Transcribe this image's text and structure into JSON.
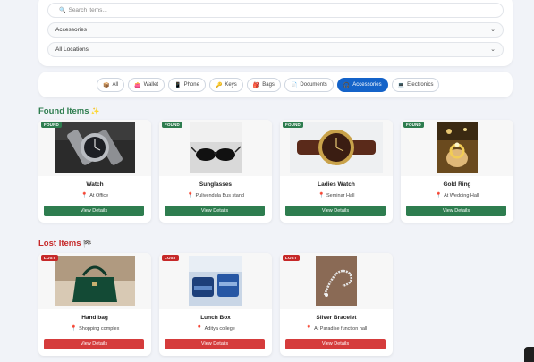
{
  "search": {
    "placeholder": "Search items..."
  },
  "filters": {
    "category": "Accessories",
    "location": "All Locations"
  },
  "chips": [
    {
      "label": "All",
      "icon": "box-icon",
      "glyph": "📦"
    },
    {
      "label": "Wallet",
      "icon": "wallet-icon",
      "glyph": "👛"
    },
    {
      "label": "Phone",
      "icon": "phone-icon",
      "glyph": "📱"
    },
    {
      "label": "Keys",
      "icon": "key-icon",
      "glyph": "🔑"
    },
    {
      "label": "Bags",
      "icon": "bag-icon",
      "glyph": "🎒"
    },
    {
      "label": "Documents",
      "icon": "document-icon",
      "glyph": "📄"
    },
    {
      "label": "Accessories",
      "icon": "headphones-icon",
      "glyph": "🎧"
    },
    {
      "label": "Electronics",
      "icon": "laptop-icon",
      "glyph": "💻"
    }
  ],
  "active_chip": "Accessories",
  "found_section": {
    "title": "Found Items",
    "emoji": "✨"
  },
  "lost_section": {
    "title": "Lost Items",
    "emoji": "🏁"
  },
  "found_items": [
    {
      "badge": "FOUND",
      "name": "Watch",
      "location": "At Office",
      "button": "View Details",
      "image": "watch-photo"
    },
    {
      "badge": "FOUND",
      "name": "Sunglasses",
      "location": "Pulivendula Bus stand",
      "button": "View Details",
      "image": "sunglasses-photo"
    },
    {
      "badge": "FOUND",
      "name": "Ladies Watch",
      "location": "Seminar Hall",
      "button": "View Details",
      "image": "ladies-watch-photo"
    },
    {
      "badge": "FOUND",
      "name": "Gold Ring",
      "location": "At Wedding Hall",
      "button": "View Details",
      "image": "gold-ring-photo"
    }
  ],
  "lost_items": [
    {
      "badge": "LOST",
      "name": "Hand bag",
      "location": "Shopping complex",
      "button": "View Details",
      "image": "handbag-photo"
    },
    {
      "badge": "LOST",
      "name": "Lunch Box",
      "location": "Aditya college",
      "button": "View Details",
      "image": "lunch-box-photo"
    },
    {
      "badge": "LOST",
      "name": "Silver Bracelet",
      "location": "At Paradise function hall",
      "button": "View Details",
      "image": "bracelet-photo"
    }
  ],
  "colors": {
    "found": "#2e7d4f",
    "lost": "#c62828",
    "accent": "#1463c9",
    "background": "#f1f3f8"
  }
}
